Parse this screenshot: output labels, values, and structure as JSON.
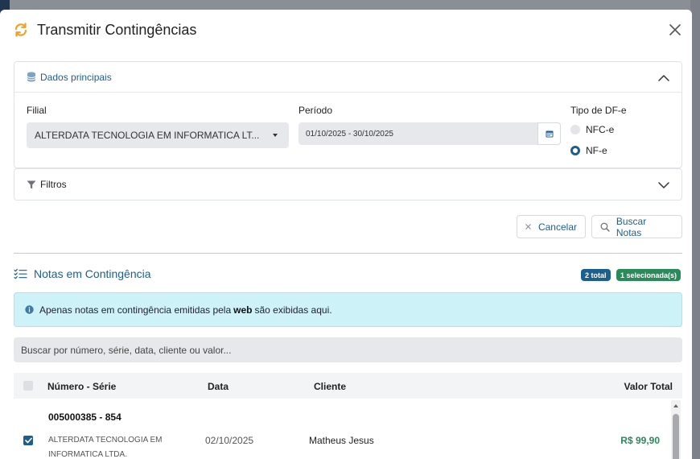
{
  "window": {
    "title": "Transmitir Contingências"
  },
  "dados": {
    "header": "Dados principais",
    "filial_label": "Filial",
    "filial_value": "ALTERDATA TECNOLOGIA EM INFORMATICA LT...",
    "periodo_label": "Período",
    "periodo_value": "01/10/2025 - 30/10/2025",
    "tipo_label": "Tipo de DF-e",
    "tipo_options": [
      {
        "label": "NFC-e",
        "selected": false
      },
      {
        "label": "NF-e",
        "selected": true
      }
    ]
  },
  "filtros": {
    "header": "Filtros"
  },
  "actions": {
    "cancel_label": "Cancelar",
    "search_label": "Buscar Notas"
  },
  "notas": {
    "title": "Notas em Contingência",
    "badge_total": "2 total",
    "badge_selected": "1 selecionada(s)",
    "alert_before": "Apenas notas em contingência emitidas pela",
    "alert_bold": "web",
    "alert_after": "são exibidas aqui.",
    "search_placeholder": "Buscar por número, série, data, cliente ou valor...",
    "columns": [
      "Número - Série",
      "Data",
      "Cliente",
      "Valor Total"
    ],
    "rows": [
      {
        "numero": "005000385 - 854",
        "emitente_line1": "ALTERDATA TECNOLOGIA EM",
        "emitente_line2": "INFORMATICA LTDA.",
        "data": "02/10/2025",
        "cliente": "Matheus Jesus",
        "valor": "R$ 99,90",
        "checked": true
      }
    ]
  },
  "colors": {
    "accent": "#1d5f8c",
    "success": "#2a8a5a",
    "badge_total": "#1d5f8c",
    "badge_selected": "#2a8a5a",
    "refresh_icon": "#f0a020",
    "alert_bg": "#cdf2f8"
  },
  "icons": {
    "title": "refresh-icon",
    "close": "close-icon",
    "dados": "database-icon",
    "filtros": "filter-icon",
    "cancel": "x-icon",
    "search": "search-icon",
    "section": "list-check-icon",
    "alert": "info-icon",
    "calendar": "calendar-icon"
  }
}
